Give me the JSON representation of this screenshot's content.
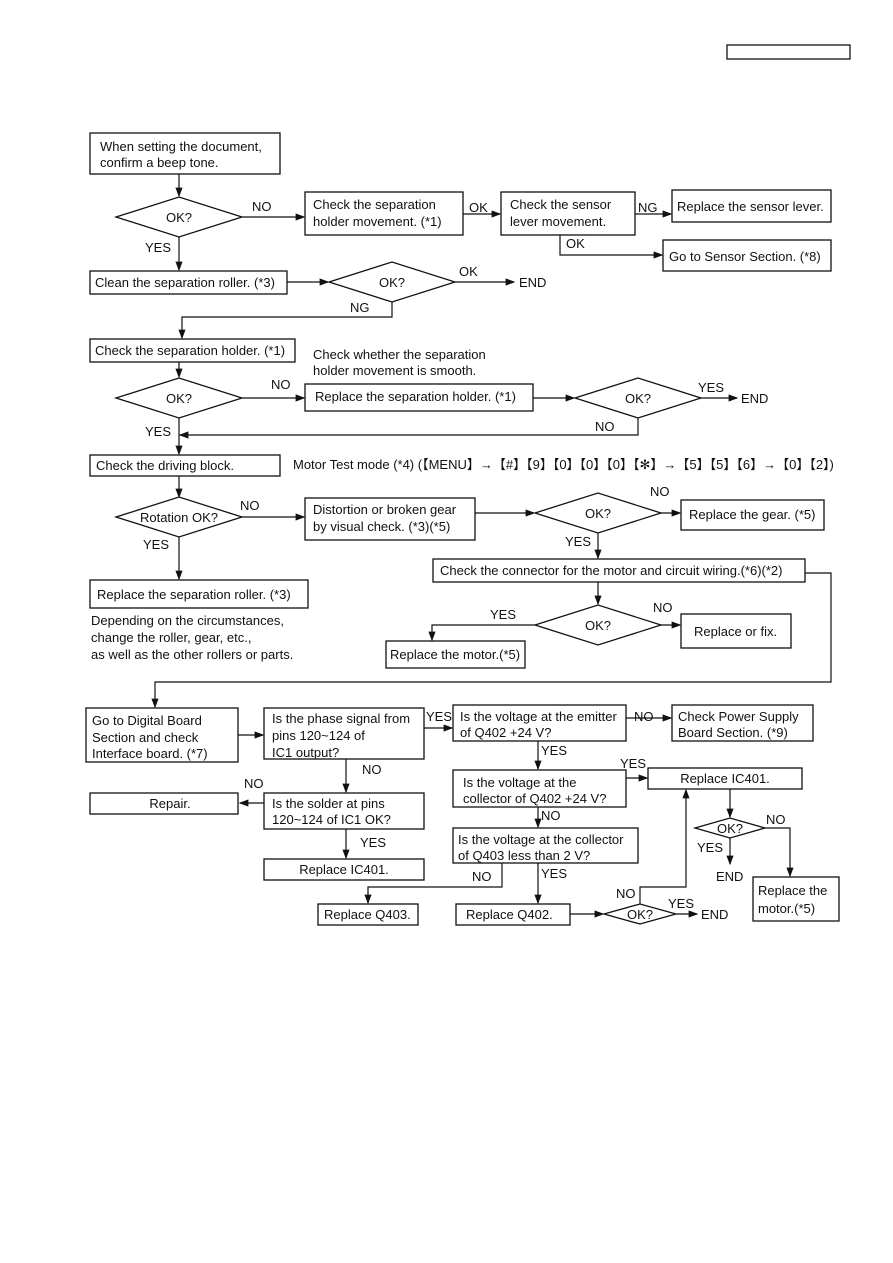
{
  "header_box": "",
  "colors": {
    "line": "#111111",
    "background": "#ffffff"
  },
  "labels": {
    "yes": "YES",
    "no": "NO",
    "ok": "OK",
    "ng": "NG",
    "end": "END",
    "ok_q": "OK?",
    "rotation_ok": "Rotation OK?"
  },
  "nodes": {
    "start": [
      "When setting the document,",
      "confirm a beep tone."
    ],
    "check_sep_holder_move": [
      "Check the separation",
      "holder movement. (*1)"
    ],
    "check_sensor_lever": [
      "Check the sensor",
      "lever movement."
    ],
    "replace_sensor_lever": "Replace the sensor lever.",
    "go_sensor_section": "Go to Sensor Section. (*8)",
    "clean_sep_roller": "Clean the separation roller. (*3)",
    "check_sep_holder": "Check the separation holder. (*1)",
    "note_smooth": [
      "Check whether the separation",
      "holder movement is smooth."
    ],
    "replace_sep_holder": "Replace the separation holder. (*1)",
    "check_driving_block": "Check the driving block.",
    "motor_test": "Motor Test mode (*4) (【MENU】→【#】【9】【0】【0】【0】【✻】→【5】【5】【6】→【0】【2】)",
    "distortion": [
      "Distortion or broken gear",
      "by visual check. (*3)(*5)"
    ],
    "replace_gear": "Replace the gear. (*5)",
    "replace_sep_roller": "Replace the separation roller. (*3)",
    "note_depending": [
      "Depending on the circumstances,",
      "change the roller, gear, etc.,",
      "as well as the other rollers or parts."
    ],
    "check_connector": "Check the connector for the motor and circuit wiring.(*6)(*2)",
    "replace_or_fix": "Replace or fix.",
    "replace_motor_1": "Replace the motor.(*5)",
    "go_digital": [
      "Go to Digital Board",
      "Section and check",
      "Interface board. (*7)"
    ],
    "phase_signal": [
      "Is the phase signal from",
      "pins 120~124 of",
      "IC1 output?"
    ],
    "emitter_q402": [
      "Is the voltage at the emitter",
      "of Q402 +24 V?"
    ],
    "check_power": [
      "Check Power Supply",
      "Board Section. (*9)"
    ],
    "repair": "Repair.",
    "solder": [
      "Is the solder at pins",
      "120~124 of IC1 OK?"
    ],
    "replace_ic401_a": "Replace IC401.",
    "collector_q402": [
      "Is the voltage at the",
      "collector of Q402 +24 V?"
    ],
    "replace_ic401_b": "Replace IC401.",
    "collector_q403": [
      "Is the voltage at the collector",
      "of Q403 less than 2 V?"
    ],
    "replace_q403": "Replace Q403.",
    "replace_q402": "Replace Q402.",
    "replace_motor_2": [
      "Replace the",
      "motor.(*5)"
    ]
  }
}
